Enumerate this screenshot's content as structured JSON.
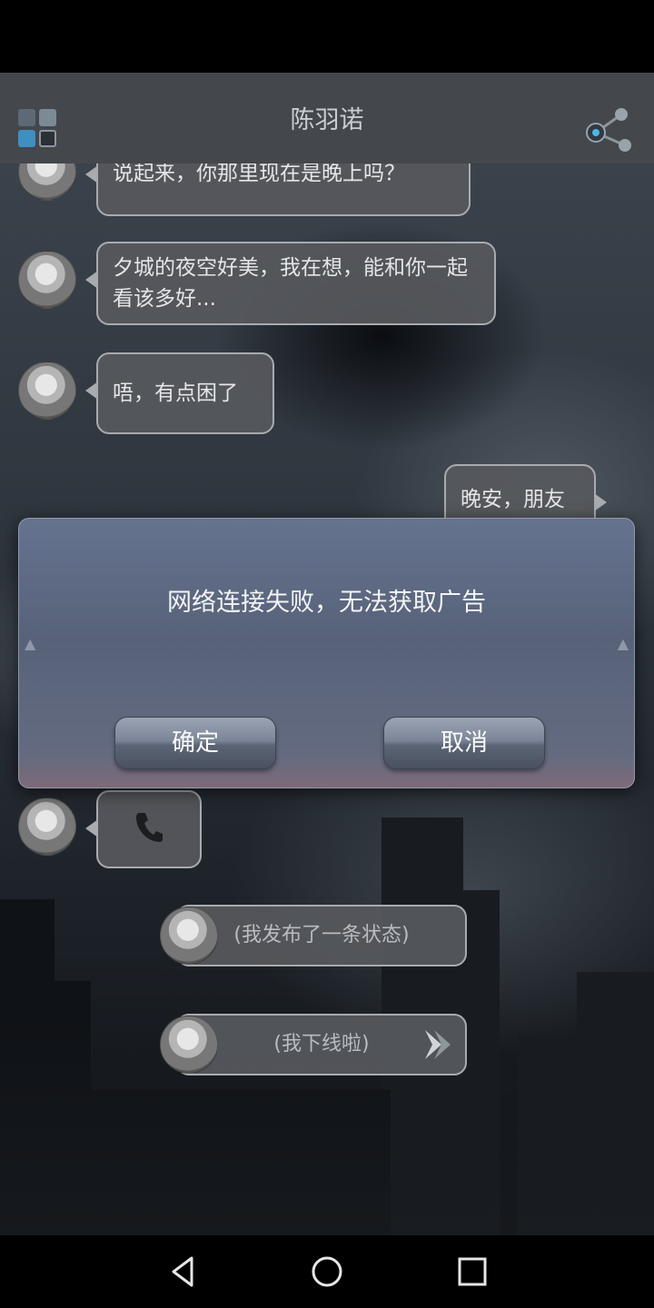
{
  "app": {
    "title": "陈羽诺",
    "menu_icon": "grid-menu-icon",
    "share_icon": "share-icon"
  },
  "messages": [
    {
      "side": "in",
      "text": "说起来，你那里现在是晚上吗？"
    },
    {
      "side": "in",
      "text": "夕城的夜空好美，我在想，能和你一起看该多好..."
    },
    {
      "side": "in",
      "text": "唔，有点困了"
    },
    {
      "side": "out",
      "text": "晚安，朋友"
    },
    {
      "side": "in",
      "type": "call",
      "icon": "phone-icon"
    }
  ],
  "status_posts": [
    {
      "text": "(我发布了一条状态)"
    },
    {
      "text": "(我下线啦)",
      "icon": "forward-arrow-icon"
    }
  ],
  "dialog": {
    "message": "网络连接失败，无法获取广告",
    "ok_label": "确定",
    "cancel_label": "取消"
  },
  "navbar": {
    "back": "back-triangle-icon",
    "home": "home-circle-icon",
    "recents": "recents-square-icon"
  },
  "colors": {
    "accent_blue": "#4fb6e6",
    "dialog_top": "#66738f",
    "bubble_fill": "#56585c"
  }
}
